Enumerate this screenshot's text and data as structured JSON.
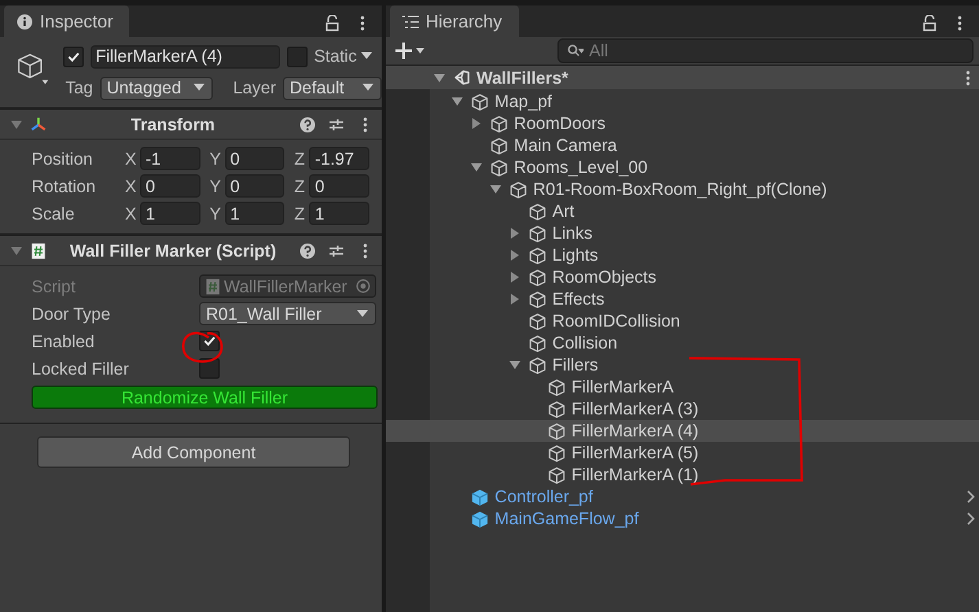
{
  "inspector": {
    "tab": "Inspector",
    "object": {
      "active": true,
      "name": "FillerMarkerA (4)",
      "static": false,
      "static_label": "Static",
      "tag_label": "Tag",
      "tag": "Untagged",
      "layer_label": "Layer",
      "layer": "Default"
    },
    "components": [
      {
        "kind": "transform",
        "title": "Transform",
        "expanded": true,
        "rows": [
          {
            "label": "Position",
            "fields": [
              {
                "axis": "X",
                "value": "-1"
              },
              {
                "axis": "Y",
                "value": "0"
              },
              {
                "axis": "Z",
                "value": "-1.97"
              }
            ]
          },
          {
            "label": "Rotation",
            "fields": [
              {
                "axis": "X",
                "value": "0"
              },
              {
                "axis": "Y",
                "value": "0"
              },
              {
                "axis": "Z",
                "value": "0"
              }
            ]
          },
          {
            "label": "Scale",
            "fields": [
              {
                "axis": "X",
                "value": "1"
              },
              {
                "axis": "Y",
                "value": "1"
              },
              {
                "axis": "Z",
                "value": "1"
              }
            ]
          }
        ]
      },
      {
        "kind": "script",
        "title": "Wall Filler Marker (Script)",
        "expanded": true,
        "props": [
          {
            "kind": "object",
            "label": "Script",
            "value": "WallFillerMarker"
          },
          {
            "kind": "dropdown",
            "label": "Door Type",
            "value": "R01_Wall Filler"
          },
          {
            "kind": "checkbox",
            "label": "Enabled",
            "checked": true
          },
          {
            "kind": "checkbox",
            "label": "Locked Filler",
            "checked": false
          }
        ],
        "button": "Randomize Wall Filler"
      }
    ],
    "add_button": "Add Component"
  },
  "hierarchy": {
    "tab": "Hierarchy",
    "search": {
      "placeholder": "All"
    },
    "tree": [
      {
        "label": "WallFillers*",
        "kind": "scene",
        "expanded": true,
        "selected": false,
        "children": [
          {
            "label": "Map_pf",
            "kind": "object",
            "expanded": true,
            "selected": false,
            "children": [
              {
                "label": "RoomDoors",
                "kind": "object",
                "expanded": false,
                "selected": false
              },
              {
                "label": "Main Camera",
                "kind": "object",
                "selected": false
              },
              {
                "label": "Rooms_Level_00",
                "kind": "object",
                "expanded": true,
                "selected": false,
                "children": [
                  {
                    "label": "R01-Room-BoxRoom_Right_pf(Clone)",
                    "kind": "object",
                    "expanded": true,
                    "selected": false,
                    "children": [
                      {
                        "label": "Art",
                        "kind": "object",
                        "selected": false
                      },
                      {
                        "label": "Links",
                        "kind": "object",
                        "expanded": false,
                        "selected": false
                      },
                      {
                        "label": "Lights",
                        "kind": "object",
                        "expanded": false,
                        "selected": false
                      },
                      {
                        "label": "RoomObjects",
                        "kind": "object",
                        "expanded": false,
                        "selected": false
                      },
                      {
                        "label": "Effects",
                        "kind": "object",
                        "expanded": false,
                        "selected": false
                      },
                      {
                        "label": "RoomIDCollision",
                        "kind": "object",
                        "selected": false
                      },
                      {
                        "label": "Collision",
                        "kind": "object",
                        "selected": false
                      },
                      {
                        "label": "Fillers",
                        "kind": "object",
                        "expanded": true,
                        "selected": false,
                        "children": [
                          {
                            "label": "FillerMarkerA",
                            "kind": "object",
                            "selected": false
                          },
                          {
                            "label": "FillerMarkerA (3)",
                            "kind": "object",
                            "selected": false
                          },
                          {
                            "label": "FillerMarkerA (4)",
                            "kind": "object",
                            "selected": true
                          },
                          {
                            "label": "FillerMarkerA (5)",
                            "kind": "object",
                            "selected": false
                          },
                          {
                            "label": "FillerMarkerA (1)",
                            "kind": "object",
                            "selected": false
                          }
                        ]
                      }
                    ]
                  }
                ]
              }
            ]
          },
          {
            "label": "Controller_pf",
            "kind": "prefab",
            "selected": false
          },
          {
            "label": "MainGameFlow_pf",
            "kind": "prefab",
            "selected": false
          }
        ]
      }
    ]
  }
}
